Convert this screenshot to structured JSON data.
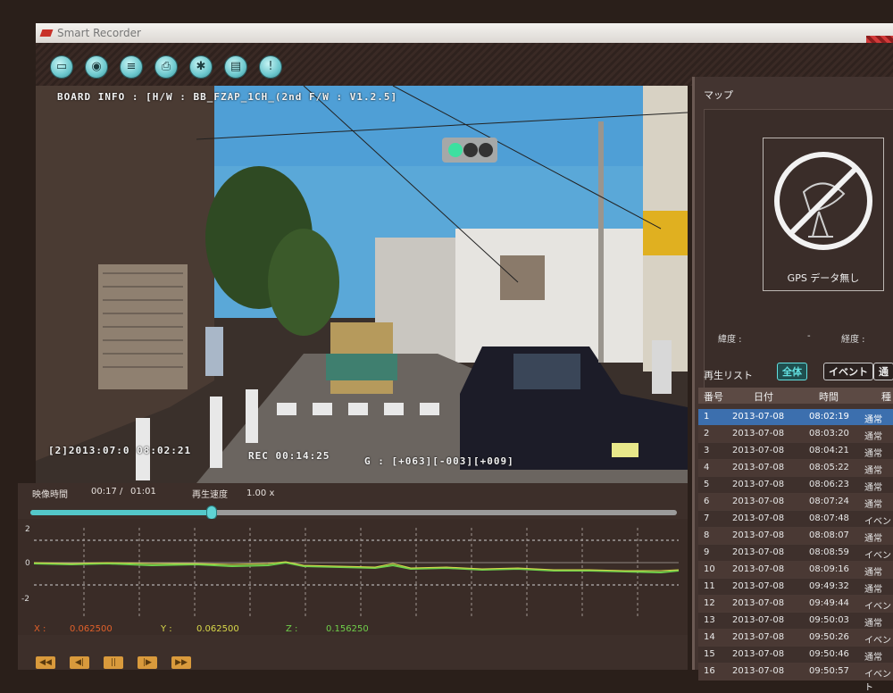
{
  "app": {
    "title": "Smart Recorder"
  },
  "toolbar": {
    "buttons": [
      {
        "icon": "folder-icon"
      },
      {
        "icon": "record-icon"
      },
      {
        "icon": "list-icon"
      },
      {
        "icon": "print-icon"
      },
      {
        "icon": "settings-icon"
      },
      {
        "icon": "save-icon"
      },
      {
        "icon": "info-icon"
      }
    ]
  },
  "video": {
    "board_info": "BOARD INFO : [H/W : BB_FZAP_1CH_(2nd F/W : V1.2.5]",
    "timestamp": "[2]2013:07:0 08:02:21",
    "rec": "REC 00:14:25",
    "gsensor": "G : [+063][-003][+009]"
  },
  "playback": {
    "video_time_label": "映像時間",
    "current_time": "00:17",
    "separator": "/",
    "total_time": "01:01",
    "speed_label": "再生速度",
    "speed_value": "1.00 x",
    "progress_fraction": 0.28,
    "graph_y_ticks": [
      "2",
      "0",
      "-2"
    ],
    "x_label": "X :",
    "x_value": "0.062500",
    "y_label": "Y :",
    "y_value": "0.062500",
    "z_label": "Z :",
    "z_value": "0.156250",
    "colors": {
      "x": "#e0602a",
      "y": "#d8d84a",
      "z": "#6fcf4a"
    }
  },
  "map": {
    "title": "マップ",
    "gps_status": "GPS データ無し",
    "latitude_label": "緯度 :",
    "latitude_value": "-",
    "longitude_label": "経度 :"
  },
  "playlist": {
    "title": "再生リスト",
    "tabs": [
      {
        "label": "全体",
        "active": true
      },
      {
        "label": "イベント",
        "active": false
      },
      {
        "label": "通",
        "active": false
      }
    ],
    "columns": [
      "番号",
      "日付",
      "時間",
      "種"
    ],
    "rows": [
      {
        "no": "1",
        "date": "2013-07-08",
        "time": "08:02:19",
        "type": "通常"
      },
      {
        "no": "2",
        "date": "2013-07-08",
        "time": "08:03:20",
        "type": "通常"
      },
      {
        "no": "3",
        "date": "2013-07-08",
        "time": "08:04:21",
        "type": "通常"
      },
      {
        "no": "4",
        "date": "2013-07-08",
        "time": "08:05:22",
        "type": "通常"
      },
      {
        "no": "5",
        "date": "2013-07-08",
        "time": "08:06:23",
        "type": "通常"
      },
      {
        "no": "6",
        "date": "2013-07-08",
        "time": "08:07:24",
        "type": "通常"
      },
      {
        "no": "7",
        "date": "2013-07-08",
        "time": "08:07:48",
        "type": "イベント"
      },
      {
        "no": "8",
        "date": "2013-07-08",
        "time": "08:08:07",
        "type": "通常"
      },
      {
        "no": "9",
        "date": "2013-07-08",
        "time": "08:08:59",
        "type": "イベント"
      },
      {
        "no": "10",
        "date": "2013-07-08",
        "time": "08:09:16",
        "type": "通常"
      },
      {
        "no": "11",
        "date": "2013-07-08",
        "time": "09:49:32",
        "type": "通常"
      },
      {
        "no": "12",
        "date": "2013-07-08",
        "time": "09:49:44",
        "type": "イベント"
      },
      {
        "no": "13",
        "date": "2013-07-08",
        "time": "09:50:03",
        "type": "通常"
      },
      {
        "no": "14",
        "date": "2013-07-08",
        "time": "09:50:26",
        "type": "イベント"
      },
      {
        "no": "15",
        "date": "2013-07-08",
        "time": "09:50:46",
        "type": "通常"
      },
      {
        "no": "16",
        "date": "2013-07-08",
        "time": "09:50:57",
        "type": "イベント"
      }
    ]
  }
}
